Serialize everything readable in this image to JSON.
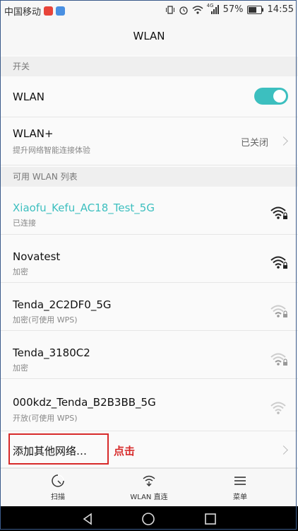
{
  "status_bar": {
    "carrier": "中国移动",
    "battery_percent": "57%",
    "time": "14:55",
    "network_label": "4G"
  },
  "header": {
    "title": "WLAN"
  },
  "sections": {
    "switch": "开关",
    "available": "可用 WLAN 列表"
  },
  "wlan_toggle": {
    "label": "WLAN",
    "on": true
  },
  "wlan_plus": {
    "label": "WLAN+",
    "sub": "提升网络智能连接体验",
    "value": "已关闭"
  },
  "networks": [
    {
      "ssid": "Xiaofu_Kefu_AC18_Test_5G",
      "status": "已连接",
      "connected": true,
      "locked": true,
      "strength": 4
    },
    {
      "ssid": "Novatest",
      "status": "加密",
      "connected": false,
      "locked": true,
      "strength": 4
    },
    {
      "ssid": "Tenda_2C2DF0_5G",
      "status": "加密(可使用 WPS)",
      "connected": false,
      "locked": true,
      "strength": 2
    },
    {
      "ssid": "Tenda_3180C2",
      "status": "加密",
      "connected": false,
      "locked": true,
      "strength": 2
    },
    {
      "ssid": "000kdz_Tenda_B2B3BB_5G",
      "status": "开放(可使用 WPS)",
      "connected": false,
      "locked": false,
      "strength": 1
    }
  ],
  "add_network": {
    "label": "添加其他网络…"
  },
  "annotation": {
    "text": "点击"
  },
  "bottom_bar": {
    "scan": "扫描",
    "wlan_direct": "WLAN 直连",
    "menu": "菜单"
  },
  "colors": {
    "accent": "#3cbfbf",
    "annotation_red": "#d72a2a",
    "connected_text": "#3cbfbf"
  },
  "icons": {
    "status_left": [
      "weibo-icon",
      "app-icon"
    ],
    "status_right": [
      "vibrate-icon",
      "alarm-icon",
      "wifi-status-icon",
      "signal-icon",
      "battery-icon"
    ],
    "nav": [
      "back-icon",
      "home-icon",
      "recents-icon"
    ]
  }
}
